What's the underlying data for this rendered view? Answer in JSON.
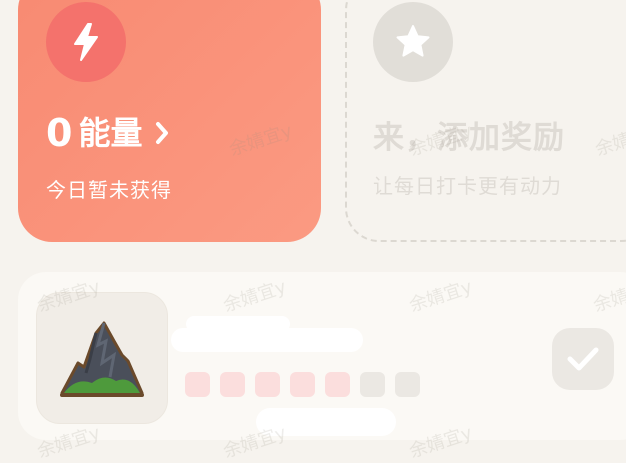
{
  "energy_card": {
    "value": "0",
    "unit": "能量",
    "subtitle": "今日暂未获得",
    "icon": "lightning-bolt-icon",
    "colors": {
      "card": "#f88a72",
      "icon_bg": "#f4726c",
      "text": "#ffffff"
    }
  },
  "reward_card": {
    "title": "来，添加奖励",
    "subtitle": "让每日打卡更有动力",
    "icon": "star-icon"
  },
  "task_card": {
    "icon": "mountain-icon",
    "progress": {
      "completed": 5,
      "total": 7
    },
    "action_icon": "check-icon"
  },
  "watermark": {
    "text": "余婧宜y"
  }
}
